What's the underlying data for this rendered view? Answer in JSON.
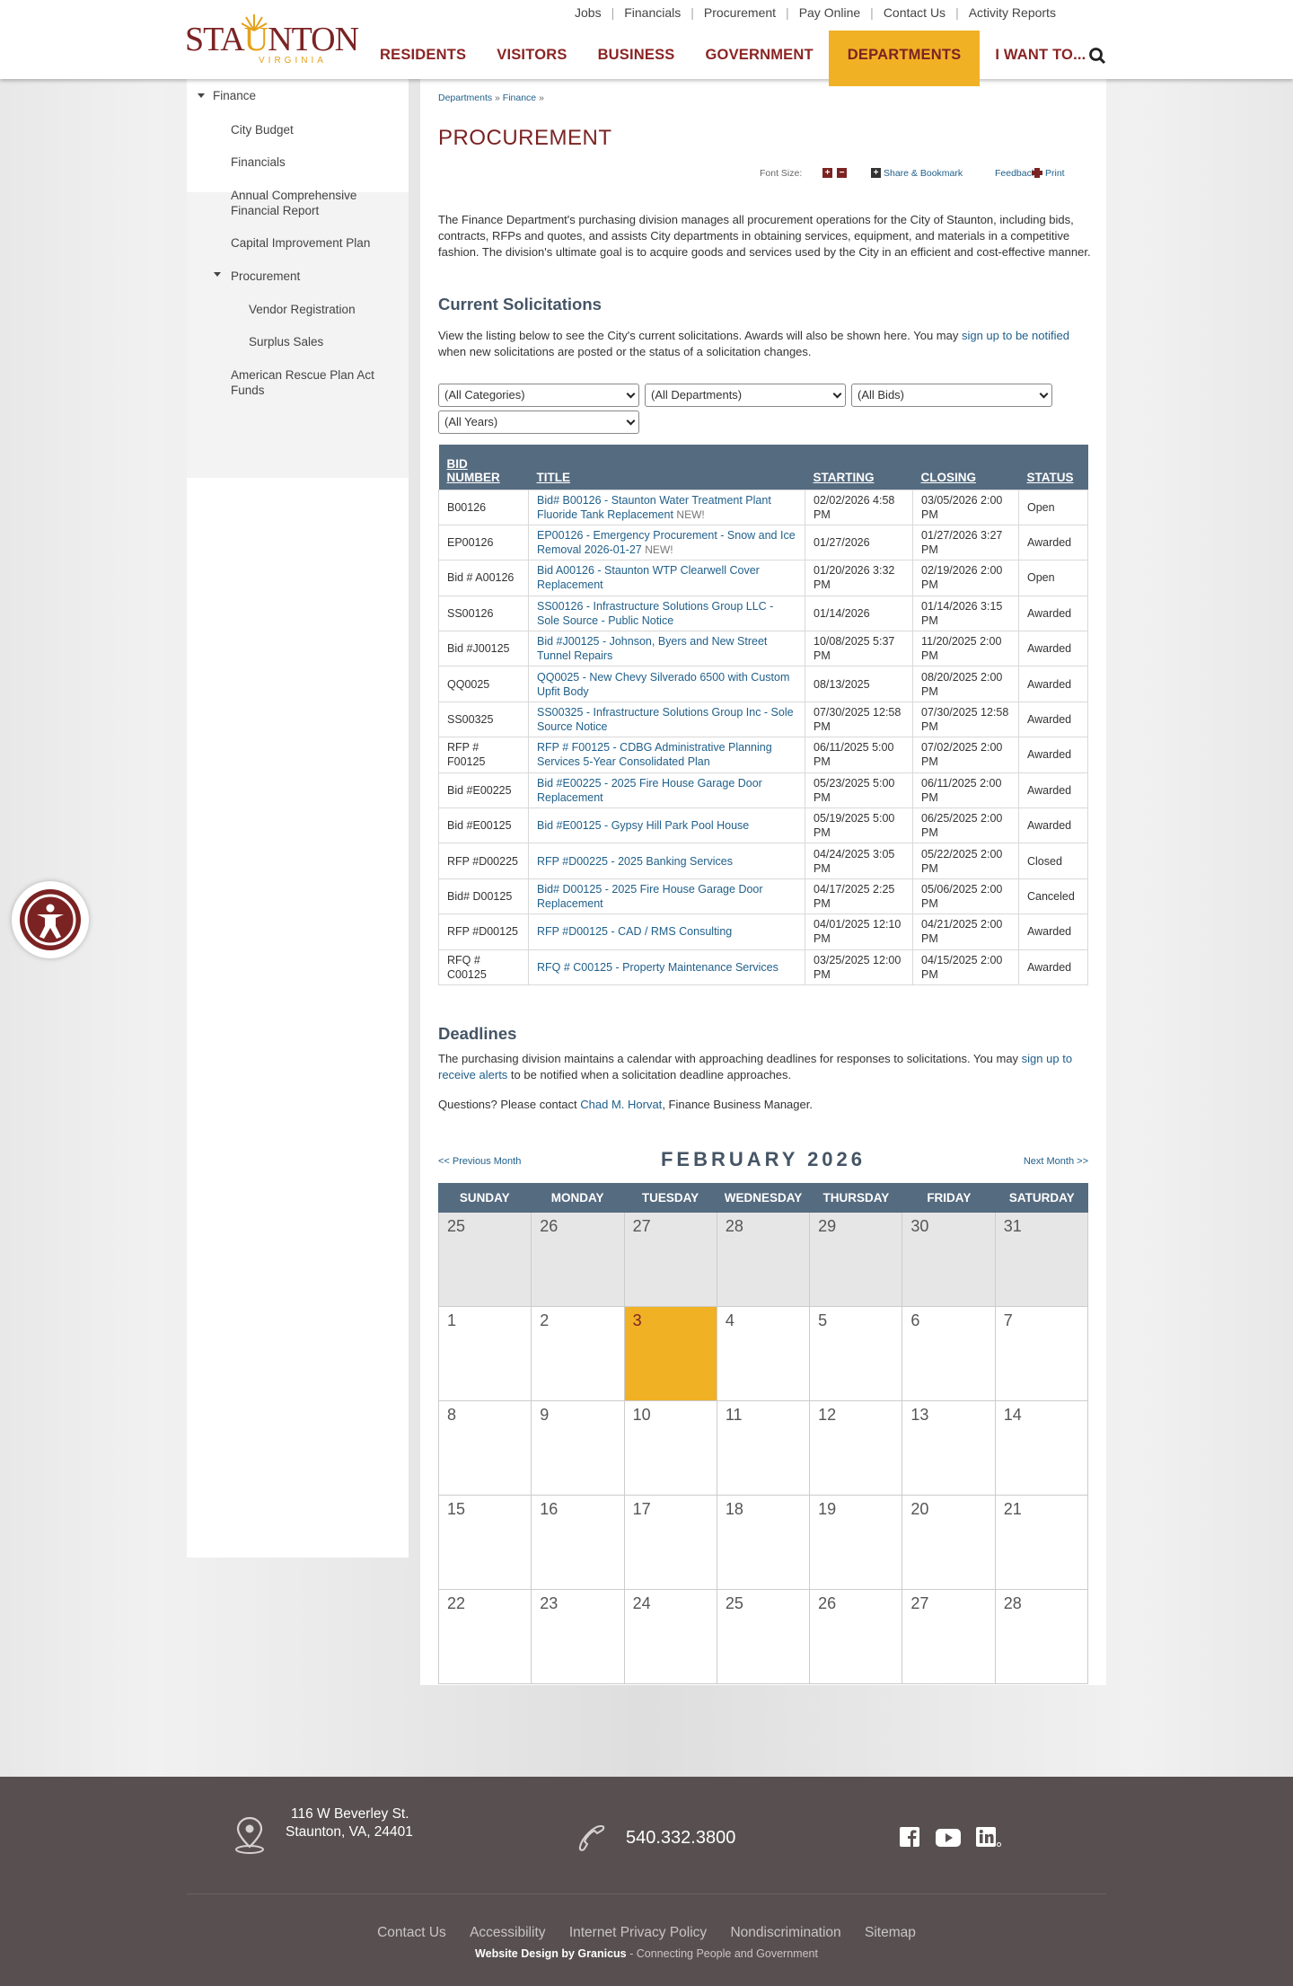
{
  "brand": {
    "name_a": "STA",
    "name_u": "U",
    "name_b": "NTON",
    "state": "VIRGINIA"
  },
  "toplinks": [
    "Jobs",
    "Financials",
    "Procurement",
    "Pay Online",
    "Contact Us",
    "Activity Reports"
  ],
  "nav": [
    "RESIDENTS",
    "VISITORS",
    "BUSINESS",
    "GOVERNMENT",
    "DEPARTMENTS",
    "I WANT TO..."
  ],
  "sidebar": {
    "finance": "Finance",
    "items": [
      "City Budget",
      "Financials",
      "Annual Comprehensive Financial Report",
      "Capital Improvement Plan",
      "Procurement",
      "Vendor Registration",
      "Surplus Sales",
      "American Rescue Plan Act Funds"
    ]
  },
  "breadcrumb": {
    "a": "Departments",
    "b": "Finance",
    "sep": "»"
  },
  "page_title": "PROCUREMENT",
  "tools": {
    "font_size": "Font Size:",
    "share": "Share & Bookmark",
    "feedback": "Feedback",
    "print": "Print"
  },
  "intro": "The Finance Department's purchasing division manages all procurement operations for the City of Staunton, including bids, contracts, RFPs and quotes, and assists City departments in obtaining services, equipment, and materials in a competitive fashion. The division's ultimate goal is to acquire goods and services used by the City in an efficient and cost-effective manner.",
  "solicit": {
    "title": "Current Solicitations",
    "text_a": "View the listing below to see the City's current solicitations. Awards will also be shown here. You may ",
    "link": "sign up to be notified",
    "text_b": " when new solicitations are posted or the status of a solicitation changes."
  },
  "filters": [
    "(All Categories)",
    "(All Departments)",
    "(All Bids)",
    "(All Years)"
  ],
  "table": {
    "headers": [
      "BID NUMBER",
      "TITLE",
      "STARTING",
      "CLOSING",
      "STATUS"
    ],
    "rows": [
      {
        "num": "B00126",
        "title": "Bid# B00126 - Staunton Water Treatment Plant Fluoride Tank Replacement",
        "new": "NEW!",
        "start": "02/02/2026 4:58 PM",
        "close": "03/05/2026 2:00 PM",
        "status": "Open"
      },
      {
        "num": "EP00126",
        "title": "EP00126 - Emergency Procurement - Snow and Ice Removal 2026-01-27",
        "new": "NEW!",
        "start": "01/27/2026",
        "close": "01/27/2026 3:27 PM",
        "status": "Awarded"
      },
      {
        "num": "Bid # A00126",
        "title": "Bid A00126 - Staunton WTP Clearwell Cover Replacement",
        "new": "",
        "start": "01/20/2026 3:32 PM",
        "close": "02/19/2026 2:00 PM",
        "status": "Open"
      },
      {
        "num": "SS00126",
        "title": "SS00126 - Infrastructure Solutions Group LLC - Sole Source - Public Notice",
        "new": "",
        "start": "01/14/2026",
        "close": "01/14/2026 3:15 PM",
        "status": "Awarded"
      },
      {
        "num": "Bid #J00125",
        "title": "Bid #J00125 - Johnson, Byers and New Street Tunnel Repairs",
        "new": "",
        "start": "10/08/2025 5:37 PM",
        "close": "11/20/2025 2:00 PM",
        "status": "Awarded"
      },
      {
        "num": "QQ0025",
        "title": "QQ0025 - New Chevy Silverado 6500 with Custom Upfit Body",
        "new": "",
        "start": "08/13/2025",
        "close": "08/20/2025 2:00 PM",
        "status": "Awarded"
      },
      {
        "num": "SS00325",
        "title": "SS00325 - Infrastructure Solutions Group Inc - Sole Source Notice",
        "new": "",
        "start": "07/30/2025 12:58 PM",
        "close": "07/30/2025 12:58 PM",
        "status": "Awarded"
      },
      {
        "num": "RFP # F00125",
        "title": "RFP # F00125 - CDBG Administrative Planning Services 5-Year Consolidated Plan",
        "new": "",
        "start": "06/11/2025 5:00 PM",
        "close": "07/02/2025 2:00 PM",
        "status": "Awarded"
      },
      {
        "num": "Bid #E00225",
        "title": "Bid #E00225 - 2025 Fire House Garage Door Replacement",
        "new": "",
        "start": "05/23/2025 5:00 PM",
        "close": "06/11/2025 2:00 PM",
        "status": "Awarded"
      },
      {
        "num": "Bid #E00125",
        "title": "Bid #E00125 - Gypsy Hill Park Pool House",
        "new": "",
        "start": "05/19/2025 5:00 PM",
        "close": "06/25/2025 2:00 PM",
        "status": "Awarded"
      },
      {
        "num": "RFP #D00225",
        "title": "RFP #D00225 - 2025 Banking Services",
        "new": "",
        "start": "04/24/2025 3:05 PM",
        "close": "05/22/2025 2:00 PM",
        "status": "Closed"
      },
      {
        "num": "Bid# D00125",
        "title": "Bid# D00125 - 2025 Fire House Garage Door Replacement",
        "new": "",
        "start": "04/17/2025 2:25 PM",
        "close": "05/06/2025 2:00 PM",
        "status": "Canceled"
      },
      {
        "num": "RFP #D00125",
        "title": "RFP #D00125 - CAD / RMS Consulting",
        "new": "",
        "start": "04/01/2025 12:10 PM",
        "close": "04/21/2025 2:00 PM",
        "status": "Awarded"
      },
      {
        "num": "RFQ # C00125",
        "title": "RFQ # C00125 - Property Maintenance Services",
        "new": "",
        "start": "03/25/2025 12:00 PM",
        "close": "04/15/2025 2:00 PM",
        "status": "Awarded"
      }
    ]
  },
  "deadlines": {
    "title": "Deadlines",
    "text_a": "The purchasing division maintains a calendar with approaching deadlines for responses to solicitations. You may ",
    "link": "sign up to receive alerts",
    "text_b": " to be notified when a solicitation deadline approaches.",
    "q_a": "Questions? Please contact ",
    "contact": "Chad M. Horvat",
    "q_b": ",  Finance Business Manager."
  },
  "calendar": {
    "prev": "<< Previous Month",
    "next": "Next Month >>",
    "month": "FEBRUARY 2026",
    "days": [
      "SUNDAY",
      "MONDAY",
      "TUESDAY",
      "WEDNESDAY",
      "THURSDAY",
      "FRIDAY",
      "SATURDAY"
    ],
    "weeks": [
      [
        "25",
        "26",
        "27",
        "28",
        "29",
        "30",
        "31"
      ],
      [
        "1",
        "2",
        "3",
        "4",
        "5",
        "6",
        "7"
      ],
      [
        "8",
        "9",
        "10",
        "11",
        "12",
        "13",
        "14"
      ],
      [
        "15",
        "16",
        "17",
        "18",
        "19",
        "20",
        "21"
      ],
      [
        "22",
        "23",
        "24",
        "25",
        "26",
        "27",
        "28"
      ]
    ]
  },
  "footer": {
    "addr1": "116 W Beverley St.",
    "addr2": "Staunton, VA, 24401",
    "phone": "540.332.3800",
    "links": [
      "Contact Us",
      "Accessibility",
      "Internet Privacy Policy",
      "Nondiscrimination",
      "Sitemap"
    ],
    "credit_b": "Website Design by Granicus",
    "credit": " - Connecting People and Government"
  }
}
